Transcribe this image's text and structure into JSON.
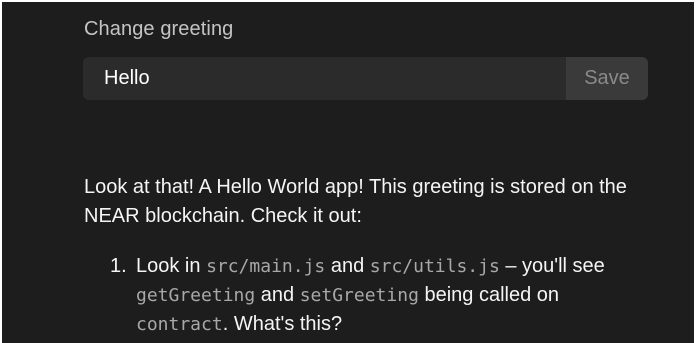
{
  "form": {
    "label": "Change greeting",
    "input_value": "Hello",
    "save_label": "Save"
  },
  "intro": "Look at that! A Hello World app! This greeting is stored on the NEAR blockchain. Check it out:",
  "steps": [
    {
      "number": "1.",
      "parts": [
        {
          "text": "Look in ",
          "code": false
        },
        {
          "text": "src/main.js",
          "code": true
        },
        {
          "text": " and ",
          "code": false
        },
        {
          "text": "src/utils.js",
          "code": true
        },
        {
          "text": " – you'll see ",
          "code": false
        },
        {
          "text": "getGreeting",
          "code": true
        },
        {
          "text": " and ",
          "code": false
        },
        {
          "text": "setGreeting",
          "code": true
        },
        {
          "text": " being called on ",
          "code": false
        },
        {
          "text": "contract",
          "code": true
        },
        {
          "text": ". What's this?",
          "code": false
        }
      ]
    }
  ],
  "colors": {
    "background": "#1d1d1d",
    "input_bg": "#2b2b2b",
    "button_bg": "#3a3a3a",
    "code_text": "#a8a8a8"
  }
}
